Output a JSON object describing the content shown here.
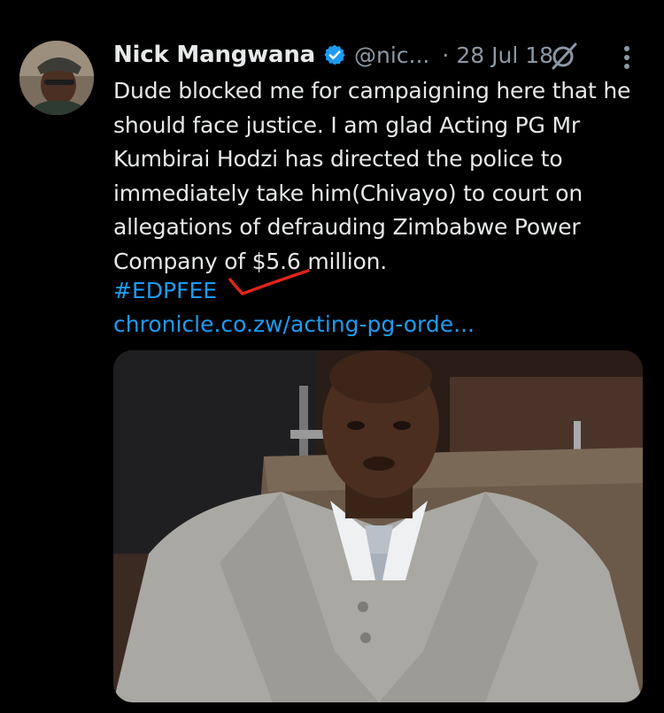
{
  "tweet": {
    "author_name": "Nick Mangwana",
    "handle": "@nic...",
    "separator": "·",
    "date": "28 Jul 18",
    "text": "Dude blocked me for campaigning here that he\nshould face justice. I am glad Acting PG Mr\nKumbirai Hodzi has directed the police to\nimmediately take him(Chivayo) to court on\nallegations of defrauding Zimbabwe Power\nCompany of $5.6 million.",
    "hashtag": "#EDPFEE",
    "link_text": "chronicle.co.zw/acting-pg-orde...",
    "verified": true
  },
  "icons": {
    "verified": "verified-badge-icon",
    "grok": "grok-icon",
    "more": "more-vertical-icon"
  },
  "colors": {
    "background": "#000000",
    "text": "#e7e9ea",
    "secondary": "#8b98a5",
    "link": "#1d9bf0",
    "annotation": "#e0251b"
  }
}
